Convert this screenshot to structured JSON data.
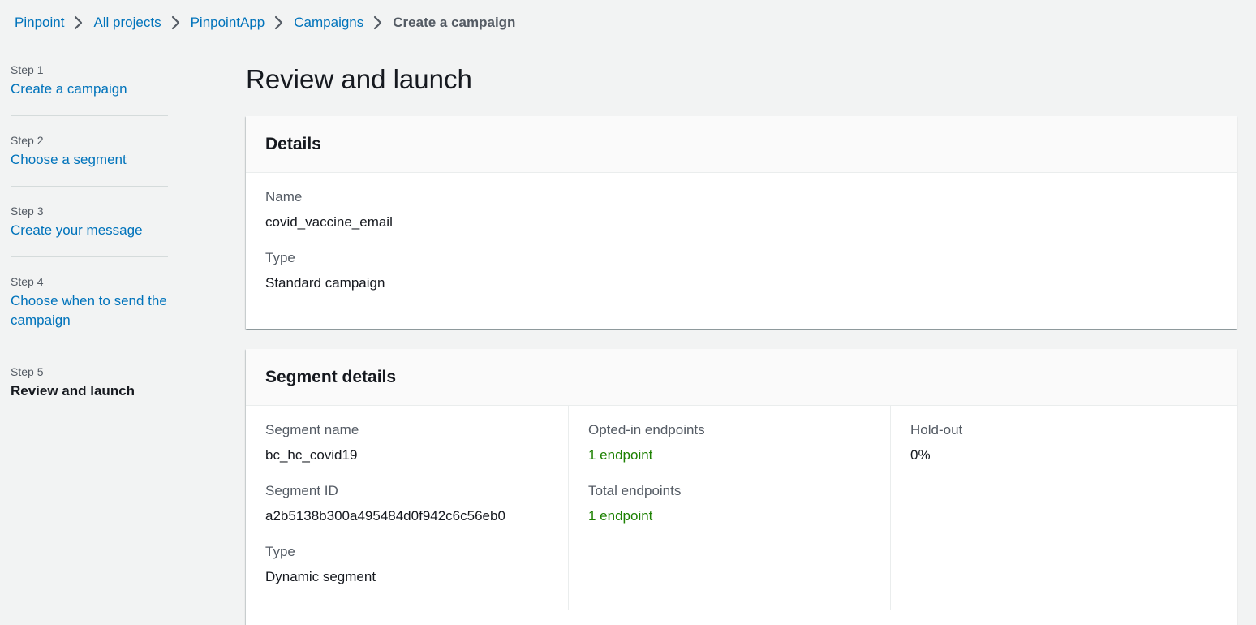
{
  "breadcrumb": {
    "items": [
      "Pinpoint",
      "All projects",
      "PinpointApp",
      "Campaigns"
    ],
    "current": "Create a campaign"
  },
  "steps": [
    {
      "num": "Step 1",
      "title": "Create a campaign"
    },
    {
      "num": "Step 2",
      "title": "Choose a segment"
    },
    {
      "num": "Step 3",
      "title": "Create your message"
    },
    {
      "num": "Step 4",
      "title": "Choose when to send the campaign"
    },
    {
      "num": "Step 5",
      "title": "Review and launch"
    }
  ],
  "page": {
    "title": "Review and launch"
  },
  "details": {
    "heading": "Details",
    "name_label": "Name",
    "name_value": "covid_vaccine_email",
    "type_label": "Type",
    "type_value": "Standard campaign"
  },
  "segment": {
    "heading": "Segment details",
    "name_label": "Segment name",
    "name_value": "bc_hc_covid19",
    "id_label": "Segment ID",
    "id_value": "a2b5138b300a495484d0f942c6c56eb0",
    "type_label": "Type",
    "type_value": "Dynamic segment",
    "opted_label": "Opted-in endpoints",
    "opted_value": "1 endpoint",
    "total_label": "Total endpoints",
    "total_value": "1 endpoint",
    "holdout_label": "Hold-out",
    "holdout_value": "0%"
  },
  "colors": {
    "link": "#0073bb",
    "success": "#1d8102",
    "background": "#f2f3f3"
  }
}
